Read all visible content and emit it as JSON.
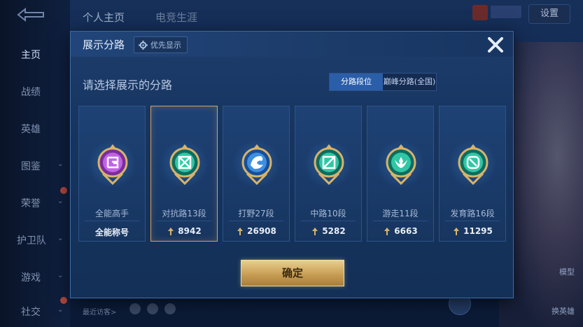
{
  "background": {
    "top_tabs": [
      "个人主页",
      "电竞生涯"
    ],
    "settings_label": "设置",
    "nav_items": [
      {
        "label": "主页",
        "active": true
      },
      {
        "label": "战绩"
      },
      {
        "label": "英雄"
      },
      {
        "label": "图鉴",
        "expand": true
      },
      {
        "label": "荣誉",
        "expand": true,
        "new": true
      },
      {
        "label": "护卫队",
        "expand": true
      },
      {
        "label": "游戏",
        "expand": true
      },
      {
        "label": "社交",
        "expand": true,
        "new": true
      }
    ],
    "recent_visitors": "最近访客>",
    "right_actions": [
      "模型",
      "换英雄"
    ]
  },
  "modal": {
    "title": "展示分路",
    "priority_label": "优先显示",
    "prompt": "请选择展示的分路",
    "segmented": [
      {
        "label": "分路段位",
        "active": true
      },
      {
        "label": "巅峰分路(全国)",
        "active": false
      }
    ],
    "cards": [
      {
        "name": "全能高手",
        "bottom": "全能称号",
        "emblem": "all-round-icon",
        "selected": false,
        "show_arrow": false
      },
      {
        "name": "对抗路13段",
        "bottom": "8942",
        "emblem": "clash-lane-icon",
        "selected": true,
        "show_arrow": true
      },
      {
        "name": "打野27段",
        "bottom": "26908",
        "emblem": "jungle-icon",
        "selected": false,
        "show_arrow": true
      },
      {
        "name": "中路10段",
        "bottom": "5282",
        "emblem": "mid-lane-icon",
        "selected": false,
        "show_arrow": true
      },
      {
        "name": "游走11段",
        "bottom": "6663",
        "emblem": "roam-icon",
        "selected": false,
        "show_arrow": true
      },
      {
        "name": "发育路16段",
        "bottom": "11295",
        "emblem": "farm-lane-icon",
        "selected": false,
        "show_arrow": true
      }
    ],
    "confirm_label": "确定"
  },
  "colors": {
    "accent_blue": "#2b5ea8",
    "gold": "#c89e55",
    "selected_border": "#d3a26b",
    "emblem_teal": "#2fc7a4",
    "emblem_purple": "#b04fd6",
    "emblem_blue": "#3e8fe0"
  }
}
